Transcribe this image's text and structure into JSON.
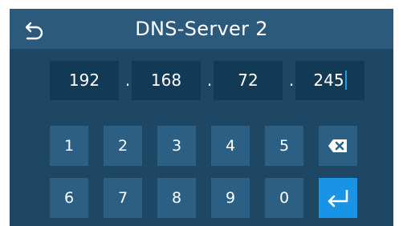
{
  "header": {
    "title": "DNS-Server 2",
    "back_icon": "back-arrow-icon"
  },
  "ip": {
    "octets": [
      "192",
      "168",
      "72",
      "245"
    ],
    "separator": "."
  },
  "keypad": {
    "row1": [
      "1",
      "2",
      "3",
      "4",
      "5"
    ],
    "row2": [
      "6",
      "7",
      "8",
      "9",
      "0"
    ],
    "backspace_icon": "backspace-icon",
    "enter_icon": "enter-icon"
  },
  "colors": {
    "background": "#1e4764",
    "header": "#2b5a7c",
    "field": "#133a55",
    "key": "#2c5f84",
    "accent": "#1993e5"
  }
}
